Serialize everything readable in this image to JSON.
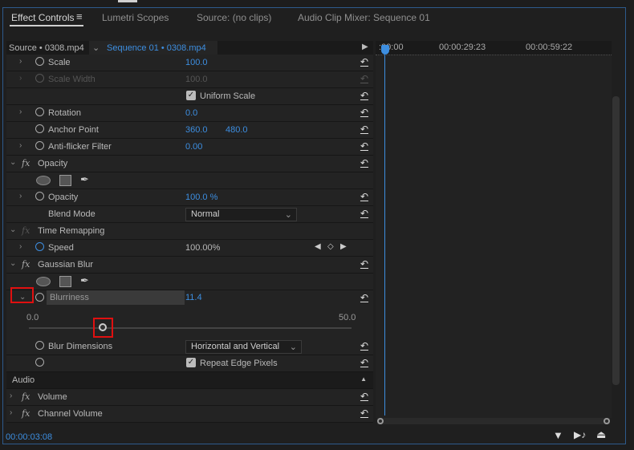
{
  "tabs": [
    {
      "label": "Effect Controls"
    },
    {
      "label": "Lumetri Scopes"
    },
    {
      "label": "Source: (no clips)"
    },
    {
      "label": "Audio Clip Mixer: Sequence 01"
    }
  ],
  "header": {
    "source": "Source • 0308.mp4",
    "sequence": "Sequence 01 • 0308.mp4"
  },
  "timeline": {
    "ticks": [
      ":00:00",
      "00:00:29:23",
      "00:00:59:22"
    ],
    "current_time": "00:00:03:08"
  },
  "rows": {
    "scale": {
      "label": "Scale",
      "value": "100.0"
    },
    "scale_width": {
      "label": "Scale Width",
      "value": "100.0"
    },
    "uniform_scale": {
      "label": "Uniform Scale",
      "checked": true
    },
    "rotation": {
      "label": "Rotation",
      "value": "0.0"
    },
    "anchor": {
      "label": "Anchor Point",
      "x": "360.0",
      "y": "480.0"
    },
    "antiflicker": {
      "label": "Anti-flicker Filter",
      "value": "0.00"
    },
    "opacity_fx": {
      "label": "Opacity"
    },
    "opacity": {
      "label": "Opacity",
      "value": "100.0 %"
    },
    "blend": {
      "label": "Blend Mode",
      "value": "Normal"
    },
    "time_remap": {
      "label": "Time Remapping"
    },
    "speed": {
      "label": "Speed",
      "value": "100.00%"
    },
    "gaussian": {
      "label": "Gaussian Blur"
    },
    "blurriness": {
      "label": "Blurriness",
      "value": "11.4",
      "min": "0.0",
      "max": "50.0",
      "fraction": 0.228
    },
    "blur_dims": {
      "label": "Blur Dimensions",
      "value": "Horizontal and Vertical"
    },
    "repeat_edge": {
      "label": "Repeat Edge Pixels",
      "checked": true
    },
    "audio": {
      "label": "Audio"
    },
    "volume": {
      "label": "Volume"
    },
    "channel_volume": {
      "label": "Channel Volume"
    }
  },
  "colors": {
    "accent": "#3d8ee0",
    "highlight": "#e01010"
  }
}
